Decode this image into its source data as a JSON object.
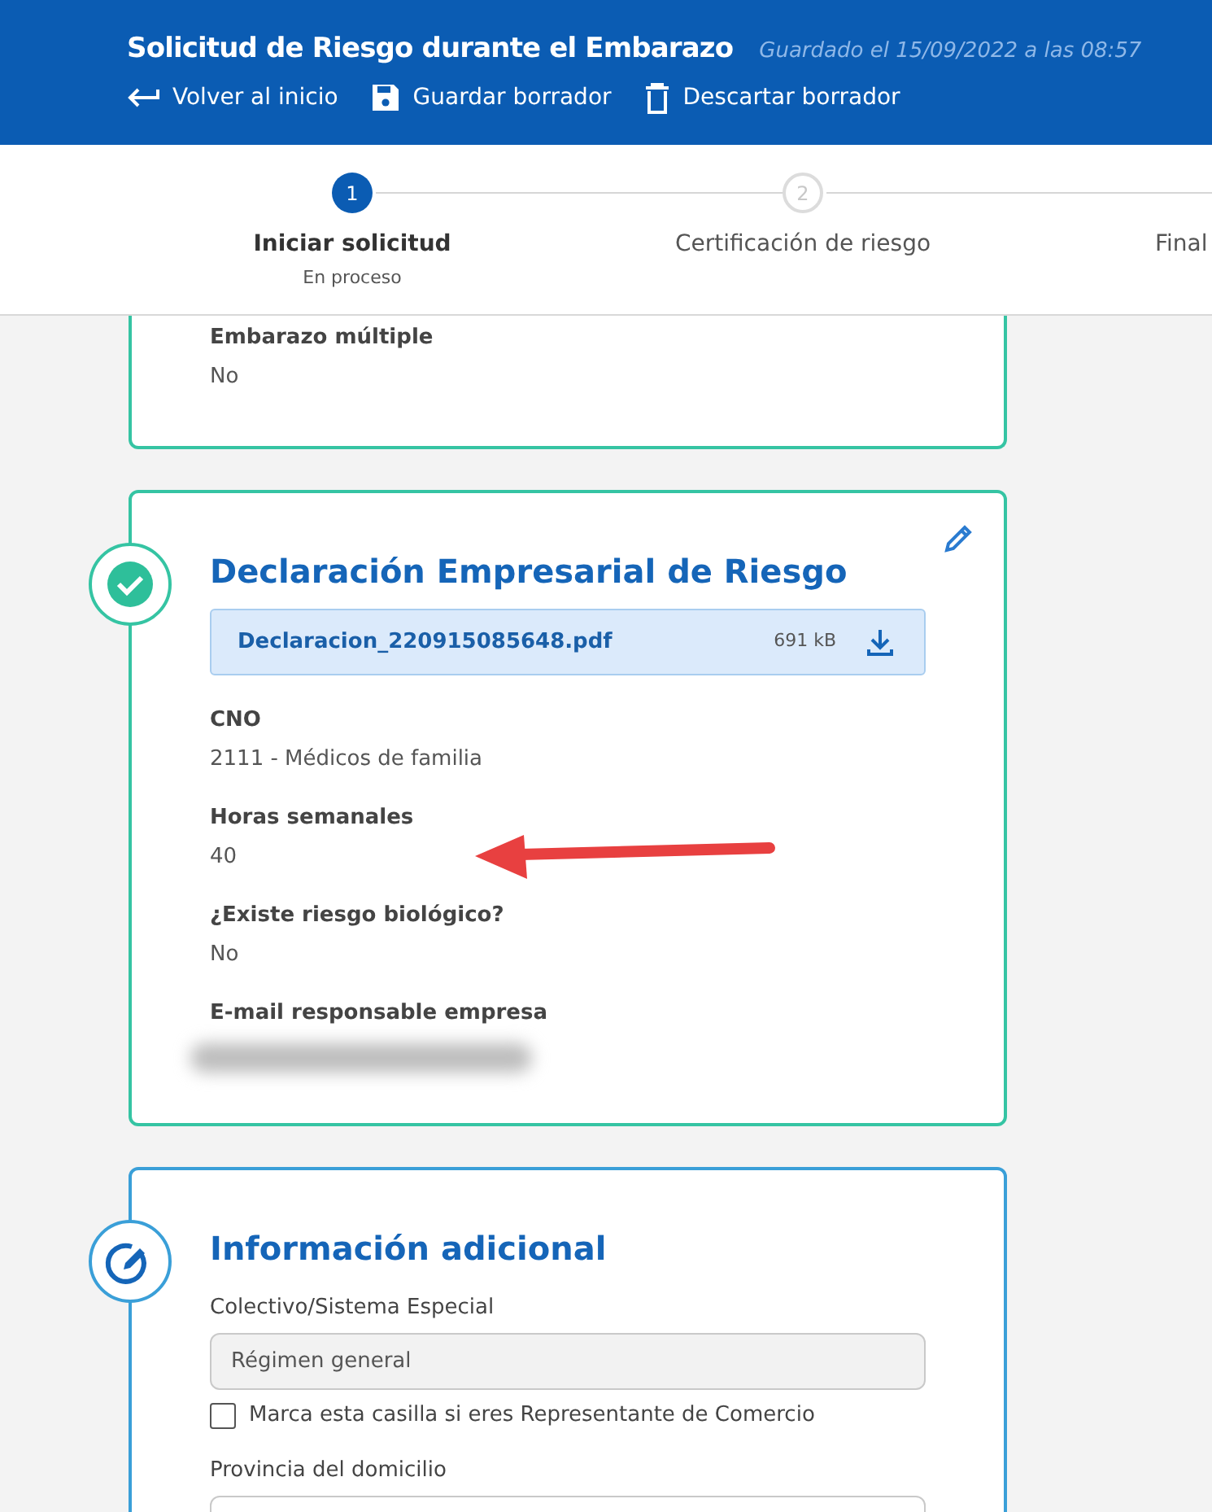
{
  "header": {
    "title": "Solicitud de Riesgo durante el Embarazo",
    "saved": "Guardado el 15/09/2022 a las 08:57",
    "actions": [
      {
        "kind": "back",
        "label": "Volver al inicio"
      },
      {
        "kind": "save",
        "label": "Guardar borrador"
      },
      {
        "kind": "discard",
        "label": "Descartar borrador"
      }
    ]
  },
  "steps": [
    {
      "number": "1",
      "label": "Iniciar solicitud",
      "sublabel": "En proceso",
      "selected": true
    },
    {
      "number": "2",
      "label": "Certificación de riesgo",
      "selected": false
    },
    {
      "label": "Final",
      "selected": false
    }
  ],
  "sections": [
    {
      "kind": "partial",
      "fields": [
        {
          "label": "Embarazo múltiple",
          "value": "No"
        }
      ]
    },
    {
      "kind": "done",
      "title": "Declaración Empresarial de Riesgo",
      "file": {
        "name": "Declaracion_220915085648.pdf",
        "size": "691 kB"
      },
      "fields": [
        {
          "label": "CNO",
          "value": "2111 - Médicos de familia"
        },
        {
          "label": "Horas semanales",
          "value": "40"
        },
        {
          "label": "¿Existe riesgo biológico?",
          "value": "No"
        },
        {
          "label": "E-mail responsable empresa",
          "redacted": true
        }
      ]
    },
    {
      "kind": "editing",
      "title": "Información adicional",
      "form": [
        {
          "kind": "input",
          "label": "Colectivo/Sistema Especial",
          "value": "Régimen general",
          "disabled": true
        },
        {
          "kind": "checkbox",
          "label": "Marca esta casilla si eres Representante de Comercio",
          "checked": false
        },
        {
          "kind": "input",
          "label": "Provincia del domicilio",
          "disabled": false
        }
      ]
    }
  ],
  "annotation": {
    "kind": "arrow"
  }
}
